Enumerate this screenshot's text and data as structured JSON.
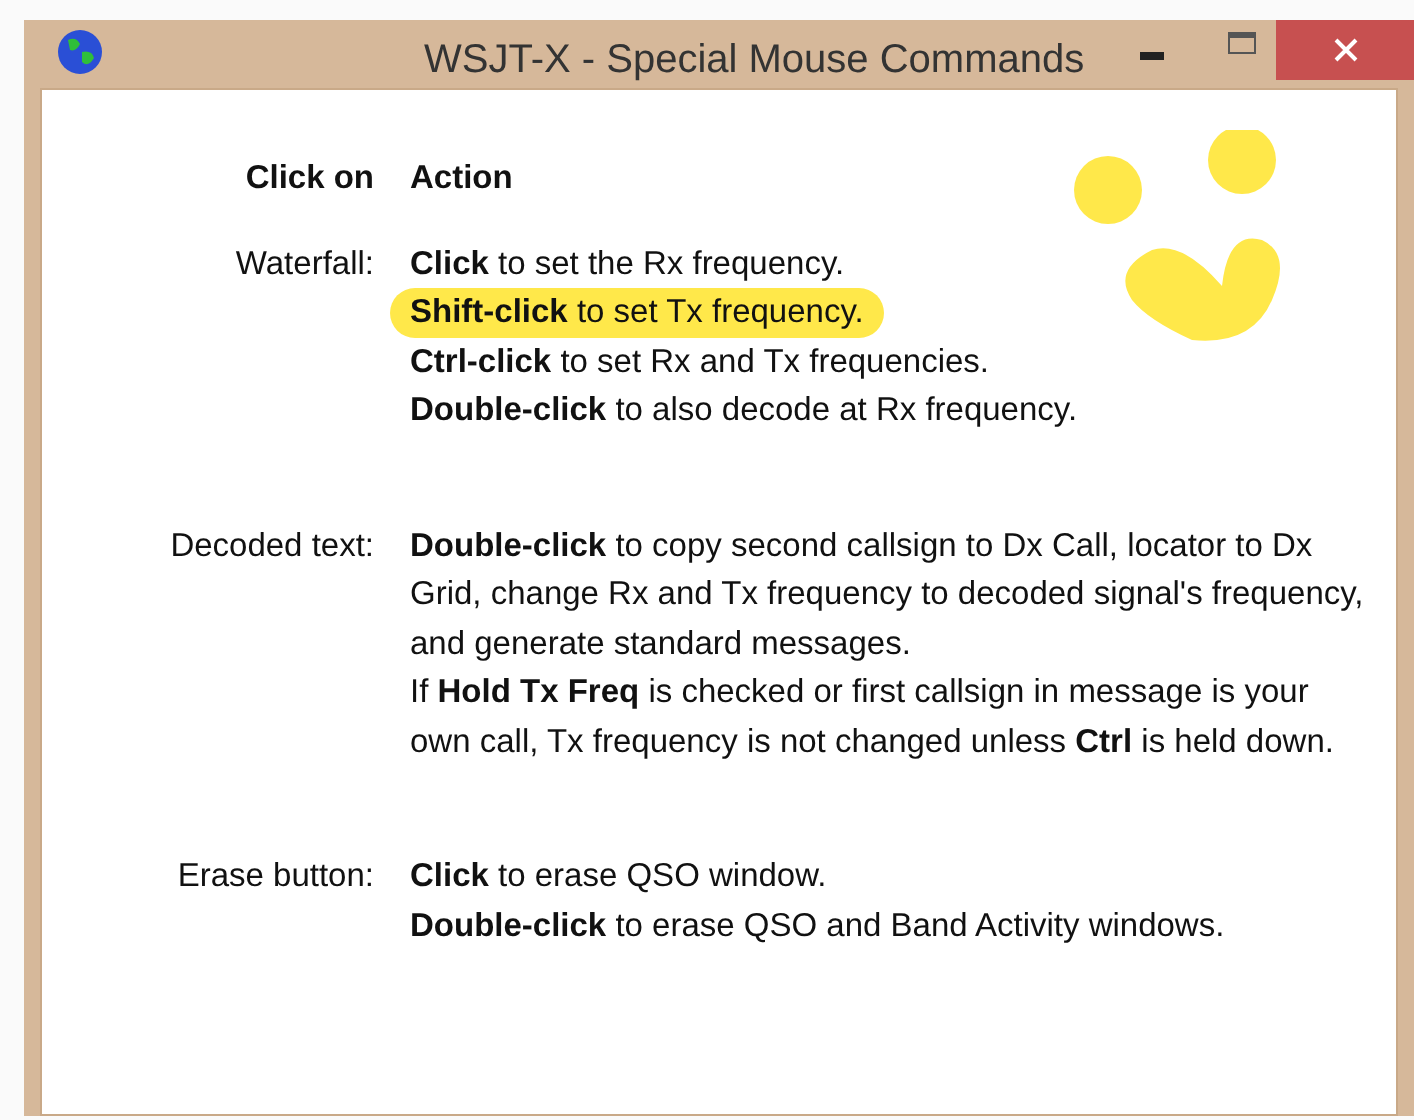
{
  "window": {
    "title": "WSJT-X - Special Mouse Commands"
  },
  "header": {
    "click_on": "Click on",
    "action": "Action"
  },
  "sections": [
    {
      "label": "Waterfall:",
      "lines": [
        {
          "text": "**Click** to set the Rx frequency.",
          "highlighted": false
        },
        {
          "text": "**Shift-click** to set Tx frequency.",
          "highlighted": true
        },
        {
          "text": "**Ctrl-click** to set Rx and Tx frequencies.",
          "highlighted": false
        },
        {
          "text": "**Double-click** to also decode at Rx frequency.",
          "highlighted": false
        }
      ]
    },
    {
      "label": "Decoded text:",
      "lines": [
        {
          "text": "**Double-click** to copy second callsign to Dx Call, locator to Dx Grid, change Rx and Tx frequency to decoded signal's frequency, and generate standard messages.",
          "highlighted": false
        },
        {
          "text": "If **Hold Tx Freq** is checked or first callsign in message is your own call, Tx frequency is not changed unless **Ctrl** is held down.",
          "highlighted": false
        }
      ]
    },
    {
      "label": "Erase button:",
      "lines": [
        {
          "text": "**Click** to erase QSO window.",
          "highlighted": false
        },
        {
          "text": "**Double-click** to erase QSO and Band Activity windows.",
          "highlighted": false
        }
      ]
    }
  ]
}
